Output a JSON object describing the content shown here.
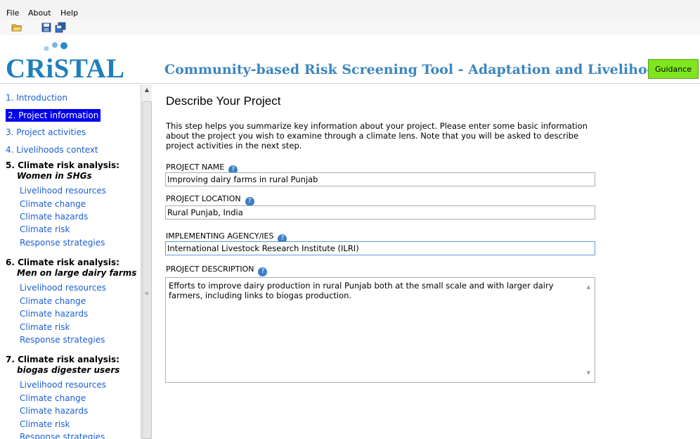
{
  "menu": {
    "file": "File",
    "about": "About",
    "help": "Help"
  },
  "toolbar": {
    "open_icon": "folder-open-icon",
    "save_icon": "save-icon",
    "save_all_icon": "save-all-icon"
  },
  "logo": {
    "text": "CRiSTAL"
  },
  "header": {
    "title": "Community-based Risk Screening Tool - Adaptation and Livelihoods",
    "guidance_label": "Guidance",
    "guidance_color": "#7fe61e"
  },
  "sidebar": {
    "intro": "1. Introduction",
    "project_info": "2. Project information",
    "project_activities": "3. Project activities",
    "livelihoods_context": "4. Livelihoods context",
    "sections": [
      {
        "title": "5. Climate risk analysis:",
        "subtitle": "Women in SHGs",
        "items": [
          "Livelihood resources",
          "Climate change",
          "Climate hazards",
          "Climate risk",
          "Response strategies"
        ]
      },
      {
        "title": "6. Climate risk analysis:",
        "subtitle": "Men on large dairy farms",
        "items": [
          "Livelihood resources",
          "Climate change",
          "Climate hazards",
          "Climate risk",
          "Response strategies"
        ]
      },
      {
        "title": "7. Climate risk analysis:",
        "subtitle": "biogas digester users",
        "items": [
          "Livelihood resources",
          "Climate change",
          "Climate hazards",
          "Climate risk",
          "Response strategies"
        ]
      }
    ],
    "active_color": "#0000ee",
    "link_color": "#1c5fd6"
  },
  "main": {
    "heading": "Describe Your Project",
    "intro": "This step helps you summarize key information about your project. Please enter some basic information about the project you wish to examine through a climate lens. Note that you will be asked to describe project activities in the next step.",
    "fields": {
      "name_label": "PROJECT NAME",
      "name_value": "Improving dairy farms in rural Punjab",
      "location_label": "PROJECT LOCATION",
      "location_value": "Rural Punjab, India",
      "agency_label": "IMPLEMENTING AGENCY/IES",
      "agency_value": "International Livestock Research Institute (ILRI)",
      "description_label": "PROJECT DESCRIPTION",
      "description_value": "Efforts to improve dairy production in rural Punjab both at the small scale and with larger dairy farmers, including links to biogas production."
    },
    "help_icon": "help-icon"
  }
}
